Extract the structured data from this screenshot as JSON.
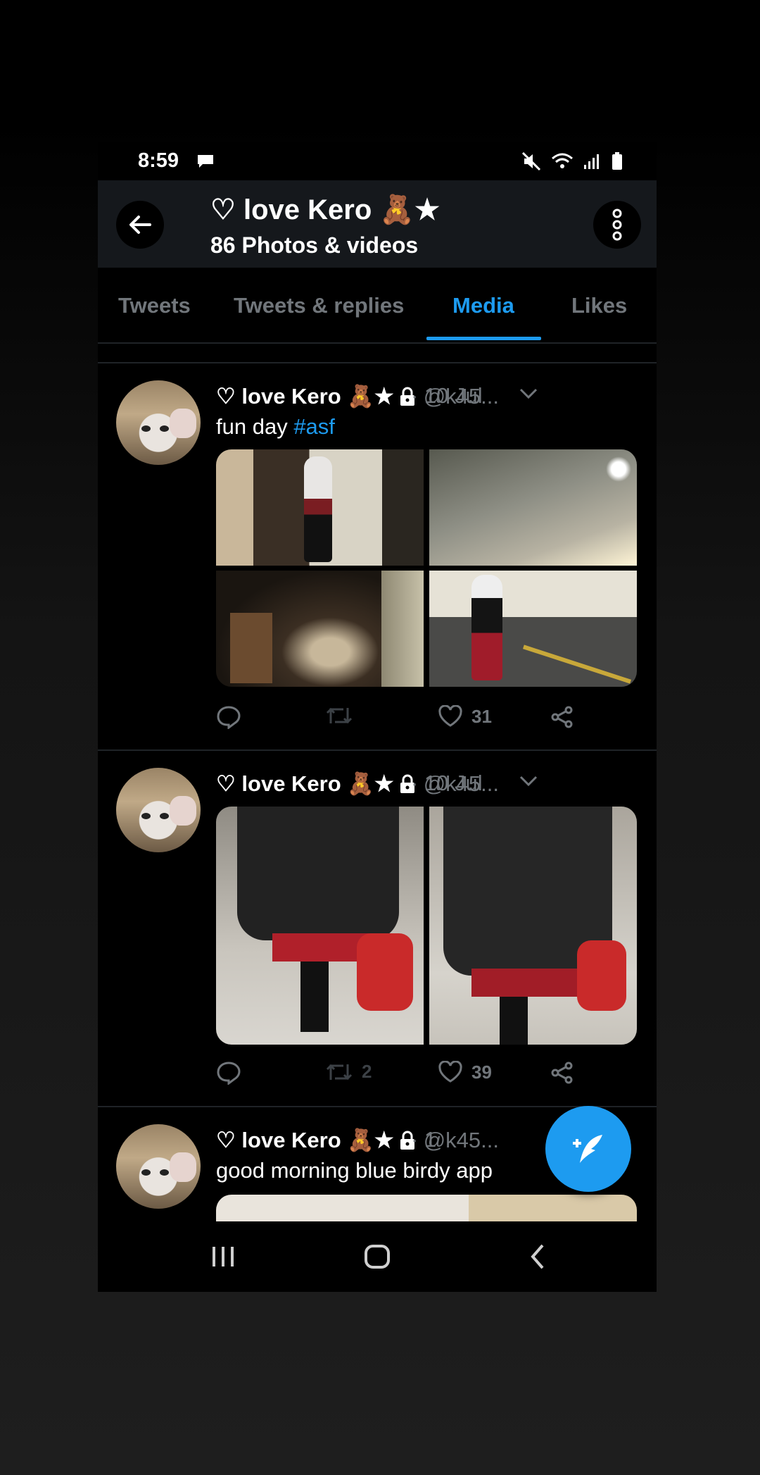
{
  "status_bar": {
    "time": "8:59"
  },
  "header": {
    "name": "♡ love Kero 🧸★",
    "subtitle": "86 Photos & videos"
  },
  "tabs": [
    {
      "label": "Tweets",
      "active": false
    },
    {
      "label": "Tweets & replies",
      "active": false
    },
    {
      "label": "Media",
      "active": true
    },
    {
      "label": "Likes",
      "active": false
    }
  ],
  "tweets": [
    {
      "name": "♡ love Kero 🧸★",
      "handle": "@k45...",
      "date": "· 10 Jul",
      "text": "fun day ",
      "hashtag": "#asf",
      "reply_count": "",
      "retweet_count": "",
      "like_count": "31"
    },
    {
      "name": "♡ love Kero 🧸★",
      "handle": "@k45...",
      "date": "· 10 Jul",
      "text": "",
      "hashtag": "",
      "reply_count": "",
      "retweet_count": "2",
      "like_count": "39"
    },
    {
      "name": "♡ love Kero 🧸★",
      "handle": "@k45...",
      "date": "· 1",
      "text": "good morning blue birdy app",
      "hashtag": ""
    }
  ],
  "fab": {
    "icon": "compose-tweet-icon"
  },
  "colors": {
    "accent": "#1d9bf0",
    "background": "#000000",
    "muted": "#71767b"
  }
}
